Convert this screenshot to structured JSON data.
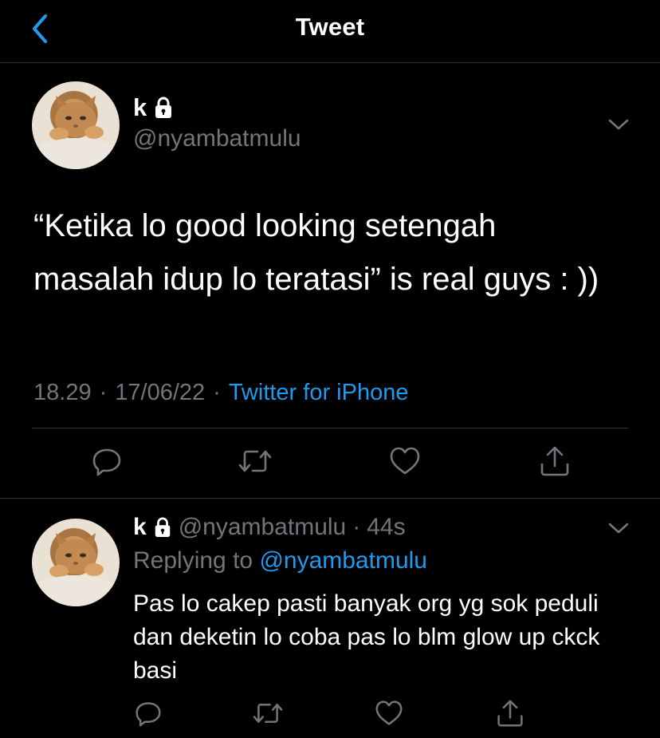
{
  "header": {
    "title": "Tweet",
    "back_icon": "chevron-left-icon"
  },
  "colors": {
    "background": "#000000",
    "text": "#ffffff",
    "muted": "#71767b",
    "accent": "#1d9bf0",
    "divider": "#2f3336"
  },
  "tweet": {
    "author_name": "k",
    "protected_icon": "lock-icon",
    "handle": "@nyambatmulu",
    "text": "“Ketika lo good looking setengah masalah idup lo teratasi” is real guys : ))",
    "time": "18.29",
    "date": "17/06/22",
    "separator": "·",
    "source": "Twitter for iPhone",
    "actions": [
      "reply-icon",
      "retweet-icon",
      "like-icon",
      "share-icon"
    ]
  },
  "reply": {
    "author_name": "k",
    "protected_icon": "lock-icon",
    "handle": "@nyambatmulu",
    "separator": "·",
    "time": "44s",
    "replying_prefix": "Replying to",
    "replying_handle": "@nyambatmulu",
    "text": "Pas lo cakep pasti banyak org yg sok peduli dan deketin lo coba pas lo blm glow up ckck basi",
    "actions": [
      "reply-icon",
      "retweet-icon",
      "like-icon",
      "share-icon"
    ]
  }
}
